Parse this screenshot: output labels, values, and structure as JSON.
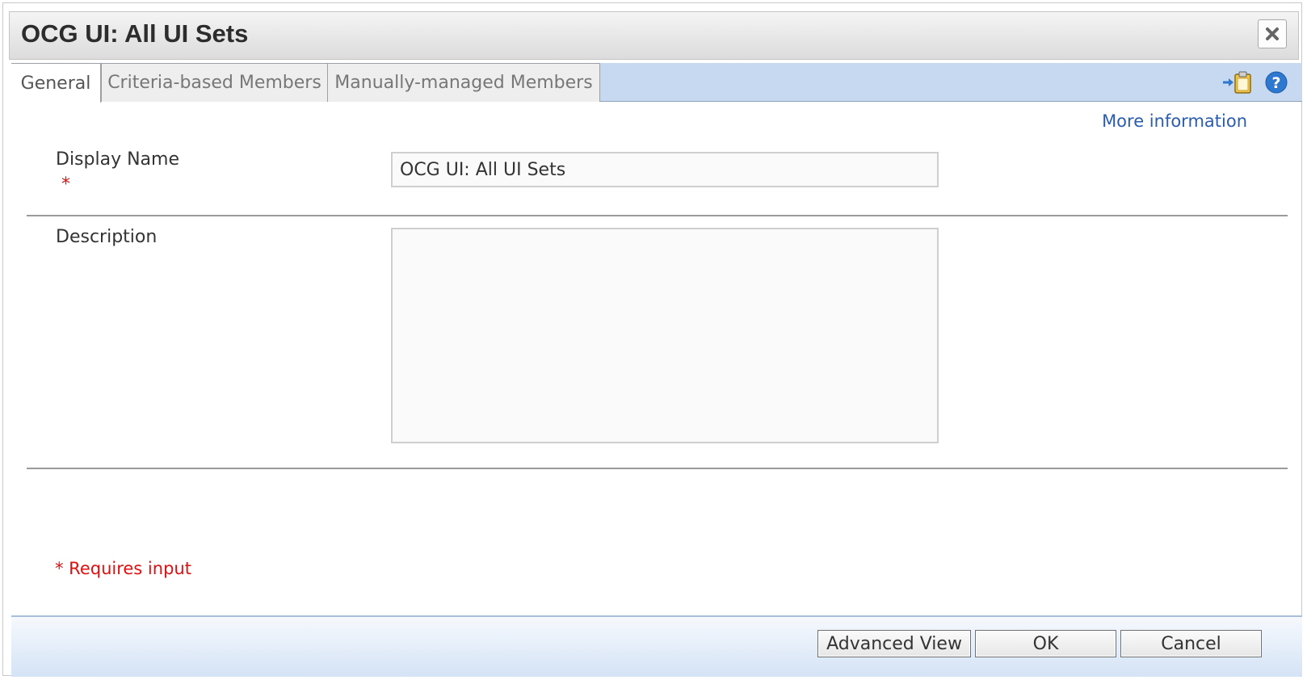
{
  "dialog": {
    "title": "OCG UI: All UI Sets",
    "close_icon": "close-icon"
  },
  "tabs": [
    {
      "label": "General",
      "active": true
    },
    {
      "label": "Criteria-based Members",
      "active": false
    },
    {
      "label": "Manually-managed Members",
      "active": false
    }
  ],
  "toolbar_icons": [
    "export-to-clipboard-icon",
    "help-icon"
  ],
  "more_information": "More information",
  "fields": {
    "display_name": {
      "label": "Display Name",
      "required_mark": "*",
      "value": "OCG UI: All UI Sets"
    },
    "description": {
      "label": "Description",
      "value": ""
    }
  },
  "requires_input_note": "* Requires input",
  "buttons": {
    "advanced_view": "Advanced View",
    "ok": "OK",
    "cancel": "Cancel"
  },
  "colors": {
    "tab_bar": "#c6d9f1",
    "link": "#2a5db0",
    "required": "#e01010",
    "help_icon": "#2f78d0"
  }
}
